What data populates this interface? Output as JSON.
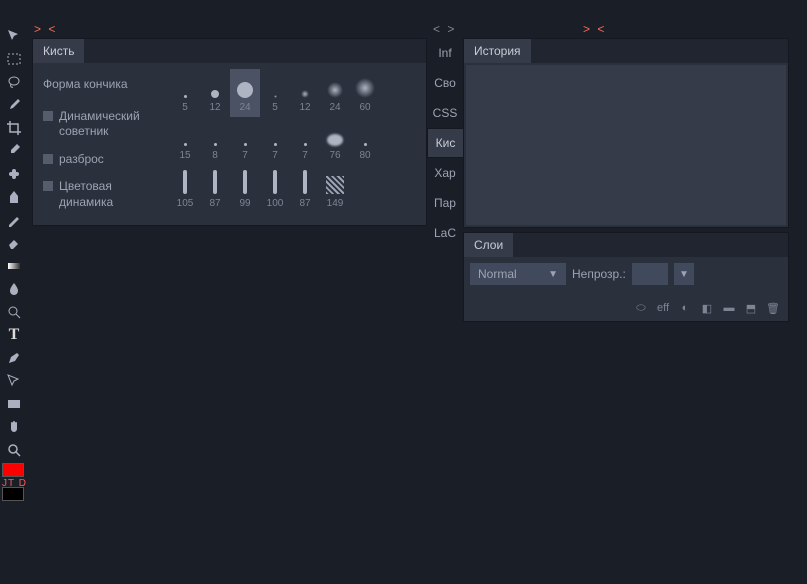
{
  "dock_handles": {
    "left": "> <",
    "mid": "< >",
    "right": "> <"
  },
  "tools": [
    "move",
    "rect-select",
    "lasso",
    "brush",
    "crop",
    "eyedropper",
    "heal",
    "clone",
    "stamp",
    "eraser",
    "gradient",
    "blur",
    "sharpen",
    "text",
    "pen",
    "shape",
    "rect",
    "hand",
    "zoom"
  ],
  "swatch": {
    "letters": "JT D"
  },
  "brush_panel": {
    "tab": "Кисть",
    "side": {
      "shape": "Форма кончика",
      "dynamic": "Динамический советник",
      "scatter": "разброс",
      "color_dyn": "Цветовая динамика"
    },
    "presets": [
      [
        {
          "s": 3,
          "l": "5"
        },
        {
          "s": 8,
          "l": "12"
        },
        {
          "s": 16,
          "l": "24",
          "sel": true
        },
        {
          "s": 3,
          "l": "5",
          "soft": true
        },
        {
          "s": 8,
          "l": "12",
          "soft": true
        },
        {
          "s": 16,
          "l": "24",
          "soft": true
        },
        {
          "s": 20,
          "l": "60",
          "soft": true
        }
      ],
      [
        {
          "s": 3,
          "l": "15"
        },
        {
          "s": 3,
          "l": "8"
        },
        {
          "s": 3,
          "l": "7"
        },
        {
          "s": 3,
          "l": "7"
        },
        {
          "s": 3,
          "l": "7"
        },
        {
          "cloud": true,
          "l": "76"
        },
        {
          "s": 3,
          "l": "80"
        }
      ],
      [
        {
          "stroke": true,
          "l": "105"
        },
        {
          "stroke": true,
          "l": "87"
        },
        {
          "stroke": true,
          "l": "99"
        },
        {
          "stroke": true,
          "l": "100"
        },
        {
          "stroke": true,
          "l": "87"
        },
        {
          "tex": true,
          "l": "149"
        }
      ]
    ]
  },
  "mid_tabs": [
    {
      "l": "Inf"
    },
    {
      "l": "Сво"
    },
    {
      "l": "CSS"
    },
    {
      "l": "Кис",
      "active": true
    },
    {
      "l": "Хар"
    },
    {
      "l": "Пар"
    },
    {
      "l": "LaC"
    }
  ],
  "history_panel": {
    "tab": "История"
  },
  "layers_panel": {
    "tab": "Слои",
    "blend_mode": "Normal",
    "opacity_label": "Непрозр.:",
    "footer_icons": [
      "link",
      "eff",
      "adjust",
      "mask",
      "folder",
      "new",
      "trash"
    ]
  }
}
